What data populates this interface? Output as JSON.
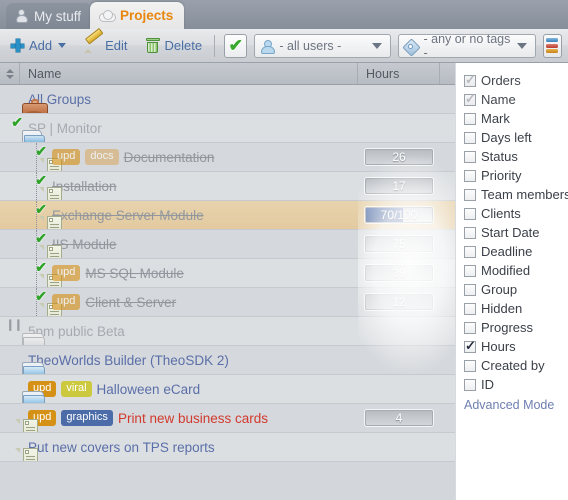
{
  "tabs": [
    {
      "label": "My stuff",
      "icon": "person-icon",
      "active": false
    },
    {
      "label": "Projects",
      "icon": "cloud-icon",
      "active": true
    }
  ],
  "toolbar": {
    "add_label": "Add",
    "edit_label": "Edit",
    "delete_label": "Delete",
    "check_glyph": "✔",
    "users_filter": "- all users -",
    "tags_filter": "- any or no tags -",
    "columns_button": "columns-icon"
  },
  "grid": {
    "columns": [
      {
        "key": "name",
        "label": "Name"
      },
      {
        "key": "hours",
        "label": "Hours"
      }
    ],
    "rows": [
      {
        "name": "All Groups",
        "icon": "briefcase-icon",
        "indent": 0,
        "style": "link",
        "tags": [],
        "hours": null,
        "selected": false,
        "stripe": "odd",
        "guide": false
      },
      {
        "name": "SP | Monitor",
        "icon": "folder-check-icon",
        "indent": 1,
        "style": "muted",
        "tags": [],
        "hours": null,
        "selected": false,
        "stripe": "even",
        "guide": false
      },
      {
        "name": "Documentation",
        "icon": "doc-check-icon",
        "indent": 2,
        "style": "done",
        "tags": [
          {
            "label": "upd",
            "color": "#d59116"
          },
          {
            "label": "docs",
            "color": "#d9ae6a"
          }
        ],
        "hours": "26",
        "progress": 0,
        "selected": false,
        "stripe": "odd",
        "guide": true
      },
      {
        "name": "Installation",
        "icon": "doc-check-icon",
        "indent": 2,
        "style": "done",
        "tags": [],
        "hours": "17",
        "progress": 0,
        "selected": false,
        "stripe": "even",
        "guide": true
      },
      {
        "name": "Exchange Server Module",
        "icon": "doc-check-icon",
        "indent": 2,
        "style": "done",
        "tags": [],
        "hours": "70/100",
        "progress": 56,
        "selected": true,
        "stripe": "odd",
        "guide": true
      },
      {
        "name": "IIS Module",
        "icon": "doc-check-icon",
        "indent": 2,
        "style": "done",
        "tags": [],
        "hours": "75",
        "progress": 0,
        "selected": false,
        "stripe": "odd",
        "guide": true
      },
      {
        "name": "MS SQL Module",
        "icon": "doc-check-icon",
        "indent": 2,
        "style": "done",
        "tags": [
          {
            "label": "upd",
            "color": "#d59116"
          }
        ],
        "hours": "39",
        "progress": 0,
        "selected": false,
        "stripe": "even",
        "guide": true
      },
      {
        "name": "Client & Server",
        "icon": "doc-check-icon",
        "indent": 2,
        "style": "done",
        "tags": [
          {
            "label": "upd",
            "color": "#d59116"
          }
        ],
        "hours": "12",
        "progress": 0,
        "selected": false,
        "stripe": "odd",
        "guide": true
      },
      {
        "name": "5pm public Beta",
        "icon": "folder-paused-icon",
        "indent": 1,
        "style": "muted",
        "tags": [],
        "hours": null,
        "selected": false,
        "stripe": "even",
        "guide": false
      },
      {
        "name": "TheoWorlds Builder (TheoSDK 2)",
        "icon": "folder-icon",
        "indent": 1,
        "style": "link",
        "tags": [],
        "hours": null,
        "selected": false,
        "stripe": "odd",
        "guide": false
      },
      {
        "name": "Halloween eCard",
        "icon": "folder-icon",
        "indent": 1,
        "style": "link",
        "tags": [
          {
            "label": "upd",
            "color": "#d59116"
          },
          {
            "label": "viral",
            "color": "#ccc93f"
          }
        ],
        "hours": null,
        "selected": false,
        "stripe": "even",
        "guide": false
      },
      {
        "name": "Print new business cards",
        "icon": "doc-icon",
        "indent": 1,
        "style": "red",
        "tags": [
          {
            "label": "upd",
            "color": "#d59116"
          },
          {
            "label": "graphics",
            "color": "#4b6ca8"
          }
        ],
        "hours": "4",
        "progress": 0,
        "selected": false,
        "stripe": "odd",
        "guide": false
      },
      {
        "name": "Put new covers on TPS reports",
        "icon": "doc-icon",
        "indent": 1,
        "style": "link",
        "tags": [],
        "hours": null,
        "selected": false,
        "stripe": "even",
        "guide": false
      }
    ]
  },
  "columns_panel": {
    "items": [
      {
        "label": "Orders",
        "checked": true,
        "disabled": true
      },
      {
        "label": "Name",
        "checked": true,
        "disabled": true
      },
      {
        "label": "Mark",
        "checked": false,
        "disabled": false
      },
      {
        "label": "Days left",
        "checked": false,
        "disabled": false
      },
      {
        "label": "Status",
        "checked": false,
        "disabled": false
      },
      {
        "label": "Priority",
        "checked": false,
        "disabled": false
      },
      {
        "label": "Team members",
        "checked": false,
        "disabled": false
      },
      {
        "label": "Clients",
        "checked": false,
        "disabled": false
      },
      {
        "label": "Start Date",
        "checked": false,
        "disabled": false
      },
      {
        "label": "Deadline",
        "checked": false,
        "disabled": false
      },
      {
        "label": "Modified",
        "checked": false,
        "disabled": false
      },
      {
        "label": "Group",
        "checked": false,
        "disabled": false
      },
      {
        "label": "Hidden",
        "checked": false,
        "disabled": false
      },
      {
        "label": "Progress",
        "checked": false,
        "disabled": false
      },
      {
        "label": "Hours",
        "checked": true,
        "disabled": false
      },
      {
        "label": "Created by",
        "checked": false,
        "disabled": false
      },
      {
        "label": "ID",
        "checked": false,
        "disabled": false
      }
    ],
    "advanced_link": "Advanced Mode"
  }
}
